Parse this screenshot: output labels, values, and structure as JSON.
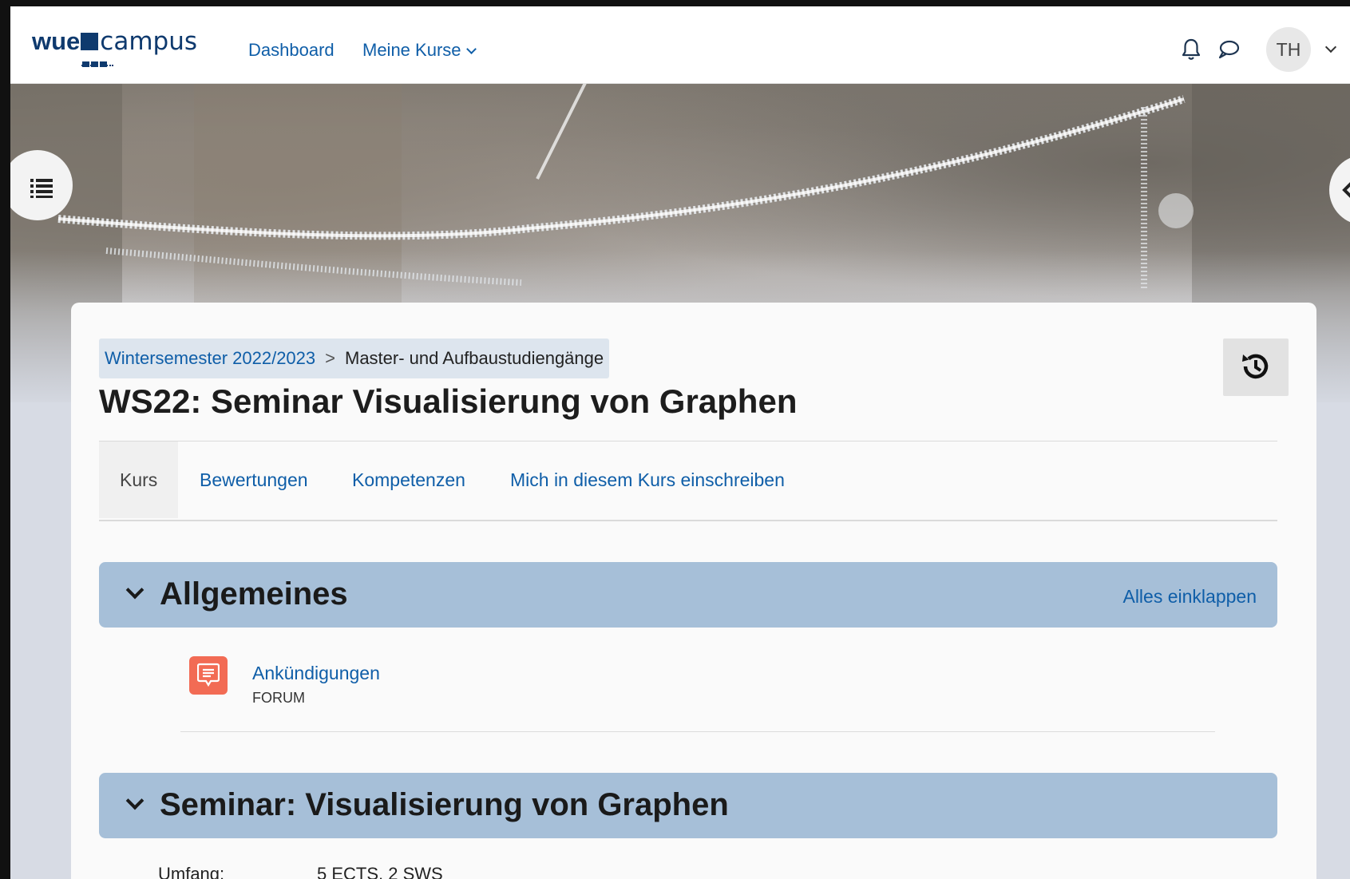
{
  "header": {
    "logo_left": "wue",
    "logo_right": "campus",
    "nav": {
      "dashboard": "Dashboard",
      "my_courses": "Meine Kurse"
    },
    "user_initials": "TH"
  },
  "breadcrumb": {
    "items": [
      "Wintersemester 2022/2023",
      "Master- und Aufbaustudiengänge"
    ],
    "separator": ">"
  },
  "page_title": "WS22: Seminar Visualisierung von Graphen",
  "tabs": [
    {
      "label": "Kurs",
      "active": true
    },
    {
      "label": "Bewertungen",
      "active": false
    },
    {
      "label": "Kompetenzen",
      "active": false
    },
    {
      "label": "Mich in diesem Kurs einschreiben",
      "active": false
    }
  ],
  "sections": [
    {
      "title": "Allgemeines",
      "action": "Alles einklappen"
    },
    {
      "title": "Seminar: Visualisierung von Graphen"
    }
  ],
  "activities": [
    {
      "name": "Ankündigungen",
      "type": "FORUM",
      "icon": "forum-icon"
    }
  ],
  "course_info": {
    "label": "Umfang:",
    "value": "5 ECTS, 2 SWS"
  },
  "colors": {
    "link": "#0f5ea8",
    "section_header": "#a6bfd8",
    "forum_icon": "#f26b54",
    "brand": "#0f3a6e"
  }
}
